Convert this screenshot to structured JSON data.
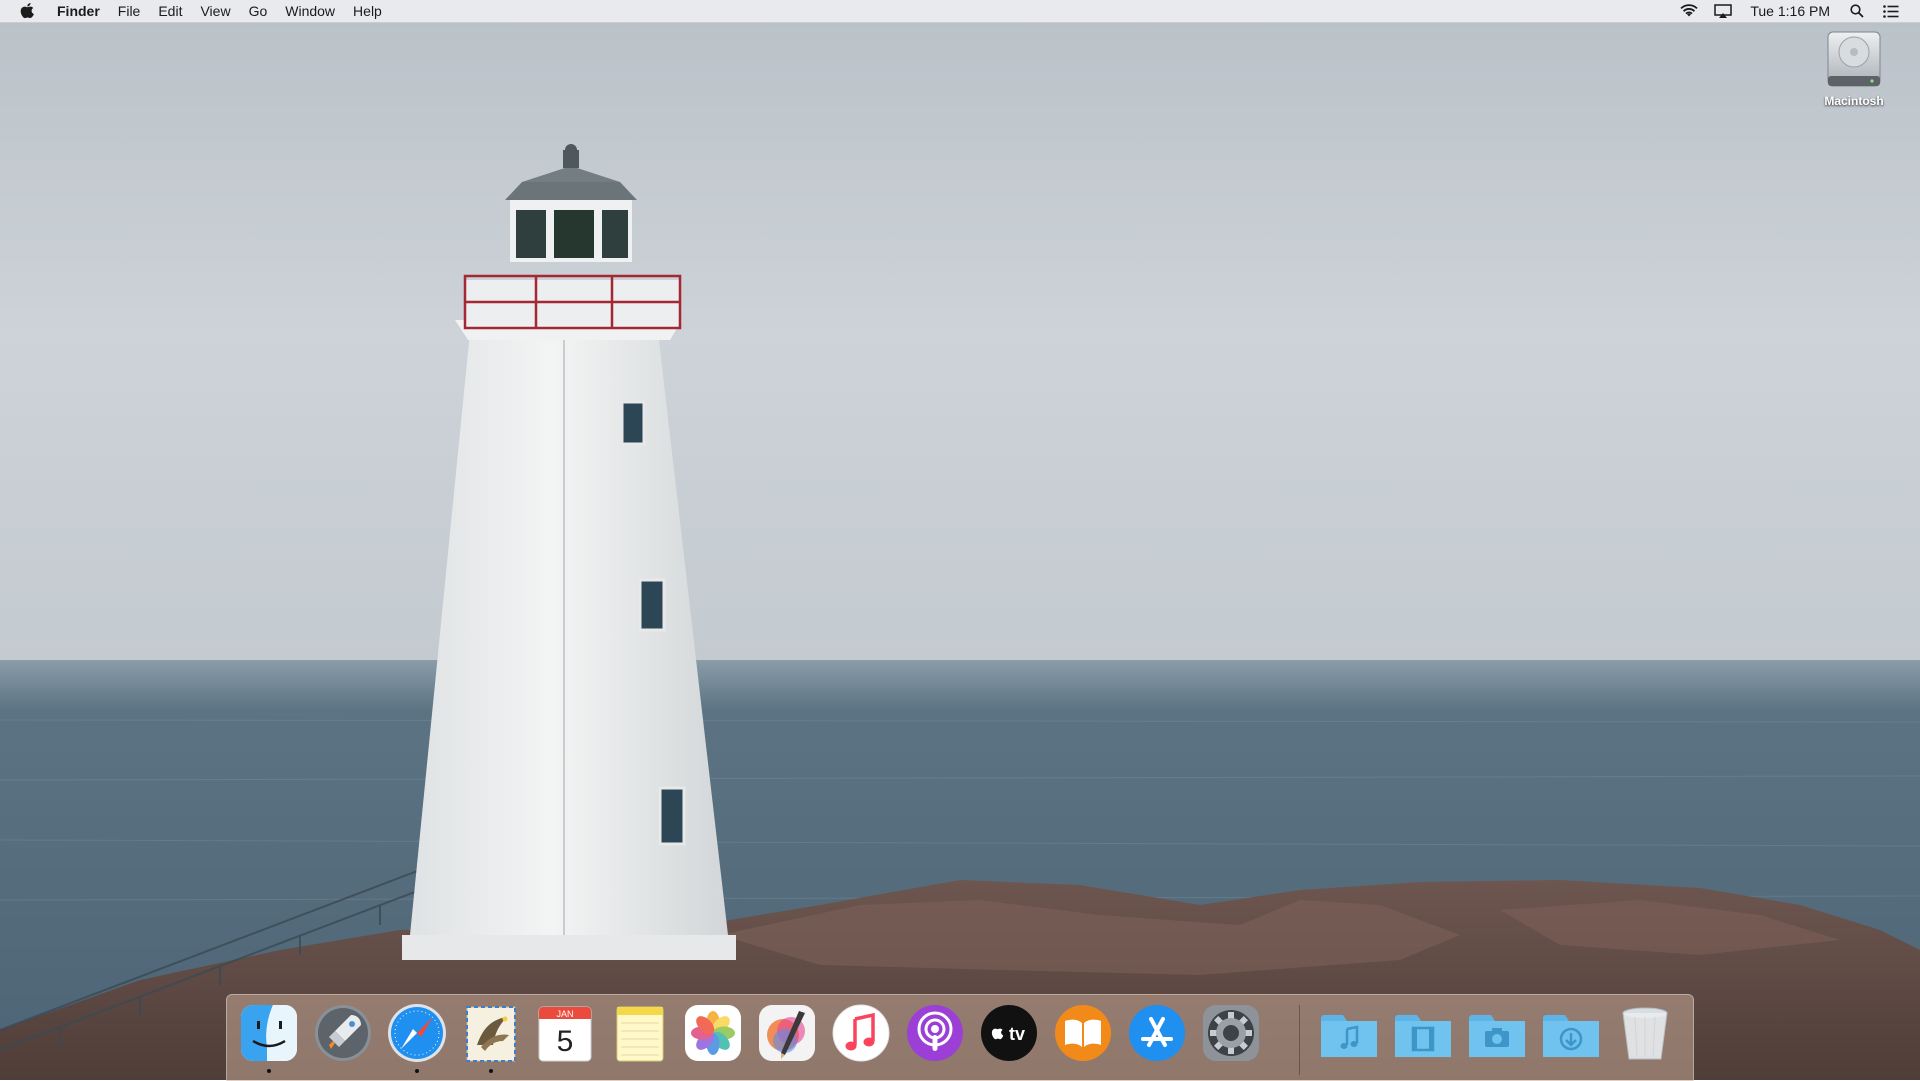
{
  "menubar": {
    "apple_icon": "apple-logo-icon",
    "app_name": "Finder",
    "menus": [
      "File",
      "Edit",
      "View",
      "Go",
      "Window",
      "Help"
    ],
    "status": {
      "wifi_icon": "wifi-icon",
      "airplay_icon": "airplay-icon",
      "clock": "Tue 1:16 PM",
      "spotlight_icon": "search-icon",
      "notifications_icon": "notification-center-icon"
    }
  },
  "desktop": {
    "wallpaper": "lighthouse on rocky coast, foggy sea",
    "icons": [
      {
        "label": "Macintosh",
        "icon": "hard-disk-icon"
      }
    ]
  },
  "dock": {
    "apps": [
      {
        "name": "finder",
        "icon": "finder-icon",
        "running": true
      },
      {
        "name": "launchpad",
        "icon": "launchpad-icon",
        "running": false
      },
      {
        "name": "safari",
        "icon": "safari-icon",
        "running": true
      },
      {
        "name": "mail",
        "icon": "mail-icon",
        "running": true
      },
      {
        "name": "calendar",
        "icon": "calendar-icon",
        "running": false,
        "month": "JAN",
        "day": "5"
      },
      {
        "name": "notes",
        "icon": "notes-icon",
        "running": false
      },
      {
        "name": "photos",
        "icon": "photos-icon",
        "running": false
      },
      {
        "name": "pixelmator",
        "icon": "pixelmator-icon",
        "running": false
      },
      {
        "name": "music",
        "icon": "music-icon",
        "running": false
      },
      {
        "name": "podcasts",
        "icon": "podcasts-icon",
        "running": false
      },
      {
        "name": "apple-tv",
        "icon": "apple-tv-icon",
        "running": false,
        "label": "tv"
      },
      {
        "name": "books",
        "icon": "books-icon",
        "running": false
      },
      {
        "name": "app-store",
        "icon": "app-store-icon",
        "running": false
      },
      {
        "name": "system-preferences",
        "icon": "gear-icon",
        "running": false
      }
    ],
    "folders": [
      {
        "name": "music-folder",
        "icon": "music-folder-icon"
      },
      {
        "name": "movies-folder",
        "icon": "movies-folder-icon"
      },
      {
        "name": "pictures-folder",
        "icon": "pictures-folder-icon"
      },
      {
        "name": "downloads-folder",
        "icon": "downloads-folder-icon"
      },
      {
        "name": "trash",
        "icon": "trash-icon"
      }
    ]
  },
  "colors": {
    "sky": "#c9d0d6",
    "sea": "#51697a",
    "rock": "#6b5248",
    "folder_blue": "#6fc3ee"
  }
}
